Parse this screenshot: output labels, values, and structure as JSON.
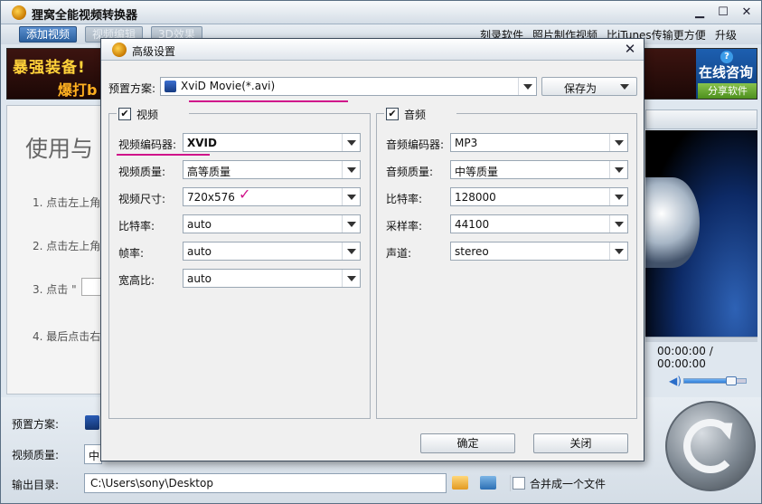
{
  "main": {
    "title": "狸窝全能视频转换器",
    "toolbar": {
      "add_video": "添加视频",
      "edit_video": "视频编辑",
      "effect_3d": "3D效果",
      "links": [
        "刻录软件",
        "照片制作视频",
        "比iTunes传输更方便",
        "升级"
      ]
    },
    "banner": {
      "line1": "暴强装备!",
      "line2": "爆打b",
      "consult_icon": "?",
      "consult": "在线咨询",
      "share": "分享软件"
    },
    "welcome": "使用与",
    "steps": [
      "1. 点击左上角",
      "2. 点击左上角",
      "3. 点击 \"",
      "4. 最后点击右"
    ],
    "preview": {
      "time": "00:00:00 / 00:00:00",
      "volume_level": 0.85
    },
    "bottom": {
      "preset_label": "预置方案:",
      "quality_label": "视频质量:",
      "quality_value": "中",
      "output_label": "输出目录:",
      "output_path": "C:\\Users\\sony\\Desktop",
      "merge_label": "合并成一个文件"
    }
  },
  "dialog": {
    "title": "高级设置",
    "preset_label": "预置方案:",
    "preset_value": "XviD Movie(*.avi)",
    "save_as": "保存为",
    "video": {
      "title": "视频",
      "checked": "✔",
      "fields": [
        {
          "label": "视频编码器:",
          "value": "XVID"
        },
        {
          "label": "视频质量:",
          "value": "高等质量"
        },
        {
          "label": "视频尺寸:",
          "value": "720x576"
        },
        {
          "label": "比特率:",
          "value": "auto"
        },
        {
          "label": "帧率:",
          "value": "auto"
        },
        {
          "label": "宽高比:",
          "value": "auto"
        }
      ]
    },
    "audio": {
      "title": "音频",
      "checked": "✔",
      "fields": [
        {
          "label": "音频编码器:",
          "value": "MP3"
        },
        {
          "label": "音频质量:",
          "value": "中等质量"
        },
        {
          "label": "比特率:",
          "value": "128000"
        },
        {
          "label": "采样率:",
          "value": "44100"
        },
        {
          "label": "声道:",
          "value": "stereo"
        }
      ]
    },
    "ok": "确定",
    "close": "关闭",
    "annotation_mark": "✓"
  },
  "colors": {
    "accent_annotation": "#d0138a",
    "toolbar_active": "#2a5f9e"
  }
}
